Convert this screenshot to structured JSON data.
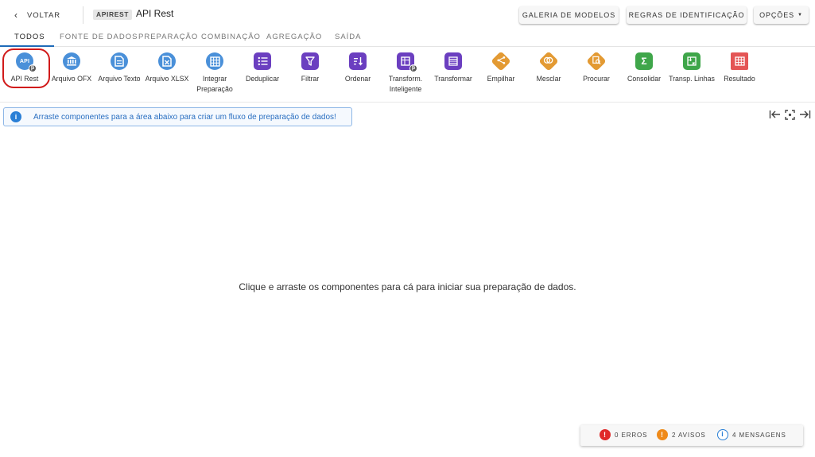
{
  "header": {
    "back_label": "VOLTAR",
    "badge": "APIREST",
    "title": "API Rest",
    "buttons": {
      "galeria": "GALERIA DE MODELOS",
      "regras": "REGRAS DE IDENTIFICAÇÃO",
      "opcoes": "OPÇÕES"
    }
  },
  "tabs": [
    {
      "label": "TODOS",
      "active": true
    },
    {
      "label": "FONTE DE DADOS"
    },
    {
      "label": "PREPARAÇÃO"
    },
    {
      "label": "COMBINAÇÃO"
    },
    {
      "label": "AGREGAÇÃO"
    },
    {
      "label": "SAÍDA"
    }
  ],
  "components": [
    {
      "label": "API Rest",
      "icon": "api-icon",
      "color": "#4a90d9",
      "beta": true,
      "selected": true
    },
    {
      "label": "Arquivo OFX",
      "icon": "bank-icon",
      "color": "#4a90d9"
    },
    {
      "label": "Arquivo Texto",
      "icon": "text-file-icon",
      "color": "#4a90d9"
    },
    {
      "label": "Arquivo XLSX",
      "icon": "xlsx-file-icon",
      "color": "#4a90d9"
    },
    {
      "label": "Integrar Preparação",
      "icon": "grid-icon",
      "color": "#4a90d9"
    },
    {
      "label": "Deduplicar",
      "icon": "list-icon",
      "color": "#6b3fc0"
    },
    {
      "label": "Filtrar",
      "icon": "filter-icon",
      "color": "#6b3fc0"
    },
    {
      "label": "Ordenar",
      "icon": "sort-icon",
      "color": "#6b3fc0"
    },
    {
      "label": "Transform. Inteligente",
      "icon": "smart-transform-icon",
      "color": "#6b3fc0",
      "beta": true
    },
    {
      "label": "Transformar",
      "icon": "transform-icon",
      "color": "#6b3fc0"
    },
    {
      "label": "Empilhar",
      "icon": "stack-icon",
      "color": "#e39a33"
    },
    {
      "label": "Mesclar",
      "icon": "merge-icon",
      "color": "#e39a33"
    },
    {
      "label": "Procurar",
      "icon": "lookup-icon",
      "color": "#e39a33"
    },
    {
      "label": "Consolidar",
      "icon": "sigma-icon",
      "color": "#3fa64a"
    },
    {
      "label": "Transp. Linhas",
      "icon": "transpose-icon",
      "color": "#3fa64a"
    },
    {
      "label": "Resultado",
      "icon": "result-icon",
      "color": "#e45555"
    }
  ],
  "info_text": "Arraste componentes para a área abaixo para criar um fluxo de preparação de dados!",
  "empty_message": "Clique e arraste os componentes para cá para iniciar sua preparação de dados.",
  "status": {
    "errors": "0 ERROS",
    "warnings": "2 AVISOS",
    "messages": "4 MENSAGENS"
  }
}
